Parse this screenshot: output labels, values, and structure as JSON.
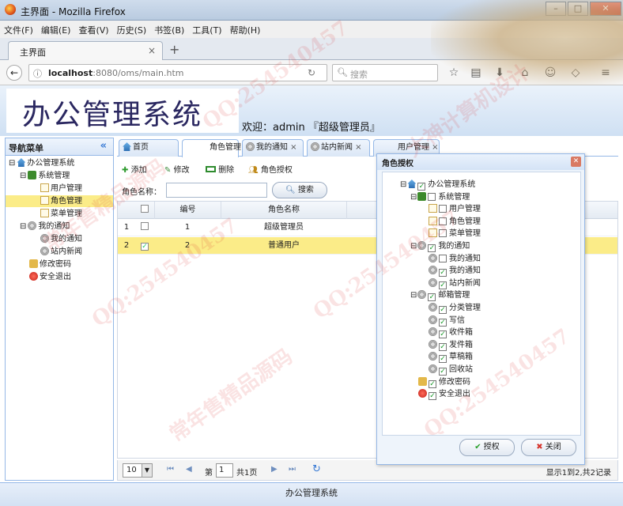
{
  "window": {
    "title": "主界面 - Mozilla Firefox"
  },
  "menubar": [
    "文件(F)",
    "编辑(E)",
    "查看(V)",
    "历史(S)",
    "书签(B)",
    "工具(T)",
    "帮助(H)"
  ],
  "browser_tab": {
    "label": "主界面",
    "close": "×",
    "new_tab": "+"
  },
  "address": {
    "url_host": "localhost",
    "url_rest": ":8080/oms/main.htm",
    "search_placeholder": "搜索"
  },
  "app": {
    "logo": "办公管理系统",
    "welcome": "欢迎：admin 『超级管理员』"
  },
  "nav": {
    "title": "导航菜单",
    "collapse": "«",
    "tree": [
      {
        "label": "办公管理系统",
        "icon": "house-icon",
        "level": 0,
        "toggle": "⊟"
      },
      {
        "label": "系统管理",
        "icon": "book-icon",
        "level": 1,
        "toggle": "⊟"
      },
      {
        "label": "用户管理",
        "icon": "page-icon",
        "level": 2
      },
      {
        "label": "角色管理",
        "icon": "page-icon",
        "level": 2,
        "selected": true
      },
      {
        "label": "菜单管理",
        "icon": "page-icon",
        "level": 2
      },
      {
        "label": "我的通知",
        "icon": "gear-icon",
        "level": 1,
        "toggle": "⊟"
      },
      {
        "label": "我的通知",
        "icon": "gear-icon",
        "level": 2
      },
      {
        "label": "站内新闻",
        "icon": "gear-icon",
        "level": 2
      },
      {
        "label": "修改密码",
        "icon": "lock-icon",
        "level": 1
      },
      {
        "label": "安全退出",
        "icon": "exit-icon",
        "level": 1
      }
    ]
  },
  "tabs": [
    {
      "label": "首页",
      "icon": "house-icon",
      "closable": false
    },
    {
      "label": "角色管理",
      "closable": true,
      "active": true
    },
    {
      "label": "我的通知",
      "icon": "gear-icon",
      "closable": true
    },
    {
      "label": "站内新闻",
      "icon": "gear-icon",
      "closable": true
    },
    {
      "label": "用户管理",
      "closable": true
    }
  ],
  "toolbar": {
    "add": "添加",
    "edit": "修改",
    "delete": "删除",
    "authorize": "角色授权"
  },
  "search": {
    "label": "角色名称：",
    "button": "搜索"
  },
  "grid": {
    "columns": [
      "编号",
      "角色名称"
    ],
    "rows": [
      {
        "index": "1",
        "checked": false,
        "id": "1",
        "name": "超级管理员"
      },
      {
        "index": "2",
        "checked": true,
        "id": "2",
        "name": "普通用户"
      }
    ]
  },
  "pager": {
    "page_size": "10",
    "page_label": "第",
    "page_value": "1",
    "total_pages": "共1页",
    "summary": "显示1到2,共2记录"
  },
  "footer": "办公管理系统",
  "dialog": {
    "title": "角色授权",
    "confirm": "授权",
    "close": "关闭",
    "tree": [
      {
        "label": "办公管理系统",
        "level": 0,
        "checked": true,
        "icon": "house-icon",
        "toggle": "⊟"
      },
      {
        "label": "系统管理",
        "level": 1,
        "checked": false,
        "icon": "book-icon",
        "toggle": "⊟"
      },
      {
        "label": "用户管理",
        "level": 2,
        "checked": false,
        "icon": "page-icon"
      },
      {
        "label": "角色管理",
        "level": 2,
        "checked": false,
        "icon": "page-icon"
      },
      {
        "label": "菜单管理",
        "level": 2,
        "checked": false,
        "icon": "page-icon"
      },
      {
        "label": "我的通知",
        "level": 1,
        "checked": true,
        "icon": "gear-icon",
        "toggle": "⊟"
      },
      {
        "label": "我的通知",
        "level": 2,
        "checked": false,
        "icon": "gear-icon"
      },
      {
        "label": "我的通知",
        "level": 2,
        "checked": true,
        "icon": "gear-icon"
      },
      {
        "label": "站内新闻",
        "level": 2,
        "checked": true,
        "icon": "gear-icon"
      },
      {
        "label": "邮箱管理",
        "level": 1,
        "checked": true,
        "icon": "gear-icon",
        "toggle": "⊟"
      },
      {
        "label": "分类管理",
        "level": 2,
        "checked": true,
        "icon": "gear-icon"
      },
      {
        "label": "写信",
        "level": 2,
        "checked": true,
        "icon": "gear-icon"
      },
      {
        "label": "收件箱",
        "level": 2,
        "checked": true,
        "icon": "gear-icon"
      },
      {
        "label": "发件箱",
        "level": 2,
        "checked": true,
        "icon": "gear-icon"
      },
      {
        "label": "草稿箱",
        "level": 2,
        "checked": true,
        "icon": "gear-icon"
      },
      {
        "label": "回收站",
        "level": 2,
        "checked": true,
        "icon": "gear-icon"
      },
      {
        "label": "修改密码",
        "level": 1,
        "checked": true,
        "icon": "lock-icon"
      },
      {
        "label": "安全退出",
        "level": 1,
        "checked": true,
        "icon": "exit-icon"
      }
    ]
  },
  "watermarks": [
    "QQ:254540457",
    "常年售精品源码",
    "大神计算机设计"
  ]
}
